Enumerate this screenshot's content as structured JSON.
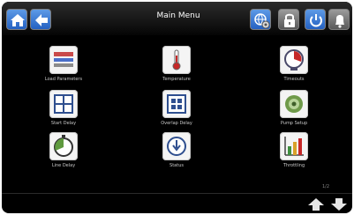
{
  "header": {
    "title": "Main Menu",
    "buttons": [
      {
        "name": "home-button",
        "icon": "home-icon"
      },
      {
        "name": "back-button",
        "icon": "arrow-left-icon"
      },
      {
        "name": "network-button",
        "icon": "globe-gear-icon"
      },
      {
        "name": "lock-button",
        "icon": "lock-icon"
      },
      {
        "name": "power-button",
        "icon": "power-icon"
      },
      {
        "name": "alarm-button",
        "icon": "bell-icon"
      }
    ]
  },
  "menu": {
    "items": [
      {
        "label": "Load Parameters",
        "icon": "parameters-icon"
      },
      {
        "label": "Temperature",
        "icon": "thermometer-icon"
      },
      {
        "label": "Timeouts",
        "icon": "clock-icon"
      },
      {
        "label": "Start Delay",
        "icon": "four-squares-icon"
      },
      {
        "label": "Overlap Delay",
        "icon": "overlap-squares-icon"
      },
      {
        "label": "Pump Setup",
        "icon": "pump-icon"
      },
      {
        "label": "Line Delay",
        "icon": "pie-timer-icon"
      },
      {
        "label": "Status",
        "icon": "status-icon"
      },
      {
        "label": "Throttling",
        "icon": "bar-chart-icon"
      }
    ]
  },
  "footer": {
    "page": "1/2",
    "prev": "arrow-up-icon",
    "next": "arrow-down-icon"
  },
  "colors": {
    "accent_blue": "#2f6fd6",
    "header_grey": "#7a7a7a",
    "background": "#000000"
  }
}
